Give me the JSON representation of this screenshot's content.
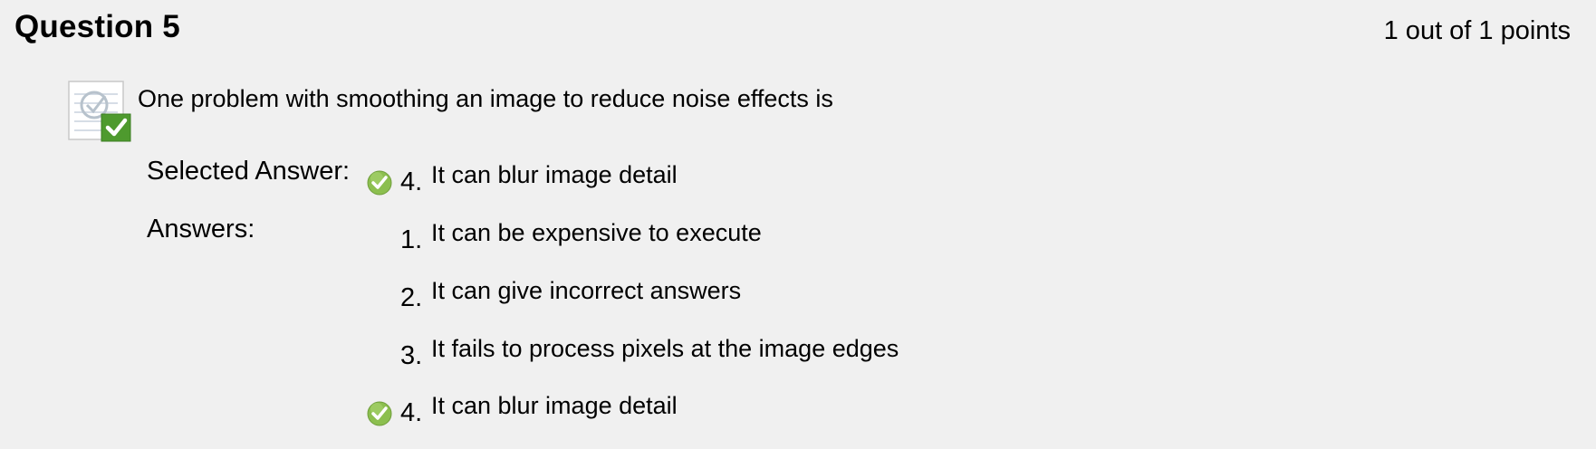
{
  "question": {
    "title": "Question 5",
    "points": "1 out of 1 points",
    "text": "One problem with smoothing an image to reduce noise effects is",
    "status_icon": "correct-answer-icon"
  },
  "selected": {
    "label": "Selected Answer:",
    "number": "4.",
    "text": "It can blur image detail",
    "correct": true
  },
  "answers": {
    "label": "Answers:",
    "items": [
      {
        "number": "1.",
        "text": "It can be expensive to execute",
        "correct": false
      },
      {
        "number": "2.",
        "text": "It can give incorrect answers",
        "correct": false
      },
      {
        "number": "3.",
        "text": "It fails to process pixels at the image edges",
        "correct": false
      },
      {
        "number": "4.",
        "text": "It can blur image detail",
        "correct": true
      }
    ]
  },
  "colors": {
    "background": "#f0f0f0",
    "check_green": "#7ab648",
    "check_badge": "#4e9a2e"
  }
}
